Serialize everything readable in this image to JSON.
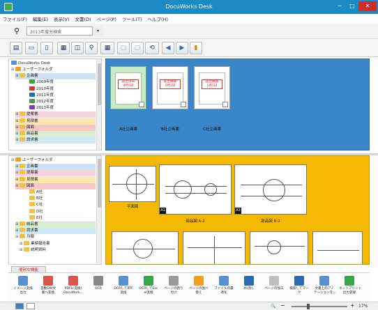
{
  "window": {
    "title": "DocuWorks Desk"
  },
  "menu": [
    "ファイル(F)",
    "編集(E)",
    "表示(V)",
    "文書(D)",
    "ページ(P)",
    "ツール(T)",
    "ヘルプ(H)"
  ],
  "search": {
    "value": "2013年度分検索"
  },
  "tree_top": {
    "root": "DocuWorks Desk",
    "items": [
      {
        "label": "ユーザーフォルダ",
        "color": "#f0a020"
      },
      {
        "label": "企画書",
        "color": "#f0c040",
        "highlight": "#cfe2f3"
      },
      {
        "label": "2009年度",
        "color": "#3aa34a"
      },
      {
        "label": "2010年度",
        "color": "#d33a3a"
      },
      {
        "label": "2011年度",
        "color": "#2a6ab0"
      },
      {
        "label": "2012年度",
        "color": "#3aa34a"
      },
      {
        "label": "2013年度",
        "color": "#8a3ab0"
      },
      {
        "label": "提案書",
        "color": "#f0c040",
        "highlight": "#f7d3e0"
      },
      {
        "label": "見積書",
        "color": "#f0c040",
        "highlight": "#fbe8b0"
      },
      {
        "label": "図面",
        "color": "#f0c040",
        "highlight": "#f6c7c7"
      },
      {
        "label": "納品書",
        "color": "#f0c040",
        "highlight": "#d8efcf"
      },
      {
        "label": "請求書",
        "color": "#f0c040",
        "highlight": "#d0e8f5"
      }
    ]
  },
  "tree_bottom": {
    "items": [
      {
        "label": "ユーザーフォルダ",
        "color": "#f0a020"
      },
      {
        "label": "企画書",
        "color": "#f0c040",
        "highlight": "#cfe2f3"
      },
      {
        "label": "提案書",
        "color": "#f0c040",
        "highlight": "#f7d3e0"
      },
      {
        "label": "見積書",
        "color": "#f0c040",
        "highlight": "#fbe8b0"
      },
      {
        "label": "図面",
        "color": "#f0c040",
        "highlight": "#f6c7c7"
      },
      {
        "label": "A社",
        "color": "#f0c040"
      },
      {
        "label": "B社",
        "color": "#f0c040"
      },
      {
        "label": "C社",
        "color": "#f0c040"
      },
      {
        "label": "D社",
        "color": "#f0c040"
      },
      {
        "label": "E社",
        "color": "#f0c040"
      },
      {
        "label": "納品書",
        "color": "#f0c040",
        "highlight": "#d8efcf"
      },
      {
        "label": "請求書",
        "color": "#f0c040",
        "highlight": "#d0e8f5"
      },
      {
        "label": "月報",
        "color": "#f0c040"
      },
      {
        "label": "業績報告書",
        "color": "#f0c040"
      },
      {
        "label": "説明資料",
        "color": "#f0c040"
      }
    ]
  },
  "upper_cards": [
    {
      "label": "A社企画書",
      "stamp": "提出済み\n4月5日"
    },
    {
      "label": "B社企画書",
      "stamp": "提出納期\n5月2日"
    },
    {
      "label": "C社企画書",
      "stamp": "提出納期\n5月5日"
    }
  ],
  "lower_drawings": [
    {
      "label": "平面図",
      "tag": ""
    },
    {
      "label": "部品図 A-2",
      "tag": "A1"
    },
    {
      "label": "部品図 B-2",
      "tag": "A3"
    }
  ],
  "feature_tab": "便利な機能",
  "features": [
    {
      "label": "イメージ変換\n出力",
      "color": "#5a8fd0"
    },
    {
      "label": "自動DW文\n書へ変換",
      "color": "#d9534f"
    },
    {
      "label": "PDFに変換(\nDocuWork...",
      "color": "#d9534f"
    },
    {
      "label": "OCR",
      "color": "#888888"
    },
    {
      "label": "OCRしてRTF\n変換",
      "color": "#5a8fd0"
    },
    {
      "label": "OCRしてExc\nel変換",
      "color": "#3aa34a"
    },
    {
      "label": "ページの割り\n付け",
      "color": "#9a9a9a"
    },
    {
      "label": "ページの並べ\n替え",
      "color": "#f0a020"
    },
    {
      "label": "ファイルの最\n適化",
      "color": "#5a8fd0"
    },
    {
      "label": "め(消し",
      "color": "#2a6ab0"
    },
    {
      "label": "ページの加工",
      "color": "#c0c0c0"
    },
    {
      "label": "検索してマー\nク",
      "color": "#2a6ab0"
    },
    {
      "label": "文書上のアノ\nテーションを...",
      "color": "#5a8fd0"
    },
    {
      "label": "ネットプリント\n出力登録",
      "color": "#3aa34a"
    }
  ],
  "status": {
    "zoom": "17%"
  }
}
